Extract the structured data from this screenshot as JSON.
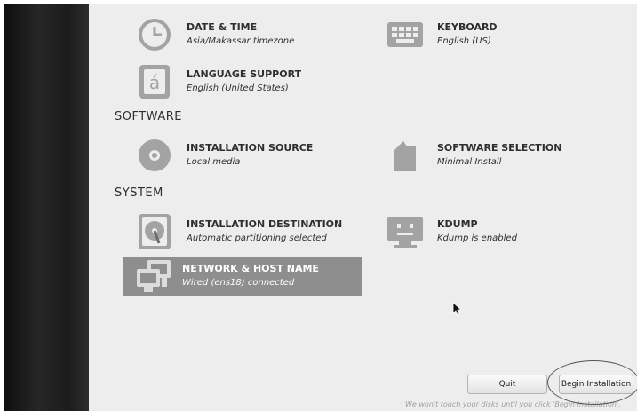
{
  "sections": {
    "software": "SOFTWARE",
    "system": "SYSTEM"
  },
  "spokes": {
    "date_time": {
      "title": "DATE & TIME",
      "status": "Asia/Makassar timezone",
      "icon": "clock-icon"
    },
    "keyboard": {
      "title": "KEYBOARD",
      "status": "English (US)",
      "icon": "keyboard-icon"
    },
    "language": {
      "title": "LANGUAGE SUPPORT",
      "status": "English (United States)",
      "icon": "language-icon"
    },
    "install_source": {
      "title": "INSTALLATION SOURCE",
      "status": "Local media",
      "icon": "disc-icon"
    },
    "software_selection": {
      "title": "SOFTWARE SELECTION",
      "status": "Minimal Install",
      "icon": "package-icon"
    },
    "install_dest": {
      "title": "INSTALLATION DESTINATION",
      "status": "Automatic partitioning selected",
      "icon": "disk-icon"
    },
    "kdump": {
      "title": "KDUMP",
      "status": "Kdump is enabled",
      "icon": "kdump-icon"
    },
    "network": {
      "title": "NETWORK & HOST NAME",
      "status": "Wired (ens18) connected",
      "icon": "network-icon"
    }
  },
  "footer": {
    "quit": "Quit",
    "begin": "Begin Installation",
    "note": "We won't touch your disks until you click 'Begin Installation'."
  },
  "colors": {
    "background": "#ededed",
    "selected": "#8e8e8e",
    "icon": "#9a9a9a"
  }
}
